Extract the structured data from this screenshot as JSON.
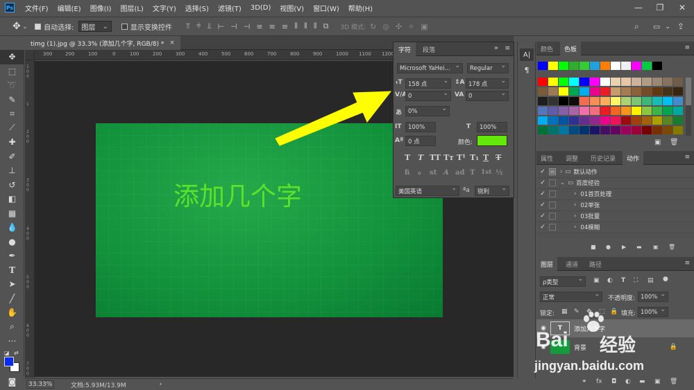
{
  "app": {
    "logo": "Ps"
  },
  "menu": [
    "文件(F)",
    "编辑(E)",
    "图像(I)",
    "图层(L)",
    "文字(Y)",
    "选择(S)",
    "滤镜(T)",
    "3D(D)",
    "视图(V)",
    "窗口(W)",
    "帮助(H)"
  ],
  "window_controls": [
    "—",
    "❐",
    "✕"
  ],
  "options": {
    "auto_select_label": "自动选择:",
    "auto_select_value": "图层",
    "show_transform_label": "显示变换控件",
    "mode_3d_label": "3D 模式:"
  },
  "doc_tab": {
    "title": "timg (1).jpg @ 33.3% (添加几个字, RGB/8) *",
    "close": "×"
  },
  "ruler_h": [
    "300",
    "200",
    "100",
    "0",
    "100",
    "200",
    "300",
    "400",
    "500",
    "600",
    "700",
    "800",
    "900",
    "1000",
    "1100",
    "1200",
    "1300"
  ],
  "ruler_v": [
    "1",
    "0",
    "0",
    "1",
    "2",
    "0",
    "0",
    "3",
    "0",
    "0",
    "4",
    "0",
    "0",
    "5",
    "0",
    "0",
    "6",
    "0",
    "0",
    "7",
    "0",
    "0"
  ],
  "canvas": {
    "text": "添加几个字",
    "text_color": "#5de22a",
    "bg_color": "#139b3c"
  },
  "status": {
    "zoom": "33.33%",
    "doc_size": "文档:5.93M/13.9M",
    "arrow": "›"
  },
  "character_panel": {
    "tabs": [
      "字符",
      "段落"
    ],
    "font_family": "Microsoft YaHei...",
    "font_style": "Regular",
    "font_size": "158 点",
    "leading": "178 点",
    "kerning": "0",
    "tracking": "0",
    "tsume": "0%",
    "v_scale": "100%",
    "h_scale": "100%",
    "baseline": "0 点",
    "color_label": "颜色:",
    "color": "#64e80a",
    "language": "美国英语",
    "aa_label": "ªa",
    "anti_alias": "锐利",
    "style_buttons": [
      "T",
      "T",
      "TT",
      "Tт",
      "T¹",
      "T₁",
      "T",
      "T"
    ],
    "opentype_buttons": [
      "fi",
      "ℴ",
      "st",
      "A",
      "ad",
      "T",
      "1st",
      "½"
    ]
  },
  "mini_strip": {
    "items": [
      "A|",
      "¶"
    ]
  },
  "swatches_panel": {
    "tabs": [
      "颜色",
      "色板"
    ],
    "rows": [
      [
        "#0000ff",
        "#ffff00",
        "#00ff00",
        "#2fae2f",
        "#33cc33",
        "#1fa1e0",
        "#ff8000",
        "#ffffff",
        "#f0f0f0",
        "#ff00ff",
        "#00cc44",
        "#000000"
      ],
      [
        "#ff0000",
        "#ffff00",
        "#00ff00",
        "#00ffff",
        "#0000ff",
        "#ff00ff",
        "#ffffff",
        "#e8d3b0",
        "#e6c6a6",
        "#ccb29a",
        "#b19c86",
        "#9b8874",
        "#85725f",
        "#6f5d4a"
      ],
      [
        "#7a5c3c",
        "#9a7b55",
        "#ffff00",
        "#00a651",
        "#00aeef",
        "#ec008c",
        "#ed1c24",
        "#c69c6d",
        "#a67c52",
        "#8c6239",
        "#754c24",
        "#603913",
        "#463219",
        "#362513"
      ],
      [
        "#1e1e1e",
        "#333333",
        "#000000",
        "#0d0d0d",
        "#f26c4f",
        "#f68e56",
        "#fbaf5d",
        "#fff568",
        "#acd373",
        "#7cc576",
        "#3bb878",
        "#1abbb4",
        "#00bff3",
        "#438ccb"
      ],
      [
        "#5574b9",
        "#605ca8",
        "#855fa8",
        "#a864a8",
        "#f06ea9",
        "#f26d7d",
        "#ed1c24",
        "#f26522",
        "#f7941d",
        "#fff200",
        "#8dc63f",
        "#39b54a",
        "#00a651",
        "#00a99d"
      ],
      [
        "#00aeef",
        "#0072bc",
        "#0054a6",
        "#2e3192",
        "#662d91",
        "#92278f",
        "#ec008c",
        "#ed145b",
        "#9e0b0f",
        "#a0410d",
        "#a3620a",
        "#aba000",
        "#598527",
        "#197b30"
      ],
      [
        "#007236",
        "#00746b",
        "#0076a3",
        "#004a80",
        "#003471",
        "#1b1464",
        "#440e62",
        "#630460",
        "#9e005d",
        "#9e0039",
        "#790000",
        "#7b2e00",
        "#7d4900",
        "#827b00"
      ]
    ]
  },
  "actions_panel": {
    "tabs": [
      "属性",
      "调整",
      "历史记录",
      "动作"
    ],
    "items": [
      {
        "check": "✓",
        "label": "默认动作",
        "kind": "folder",
        "open": false
      },
      {
        "check": "✓",
        "label": "百度经验",
        "kind": "folder",
        "open": true
      },
      {
        "check": "✓",
        "label": "01首页处理",
        "kind": "action"
      },
      {
        "check": "✓",
        "label": "02单张",
        "kind": "action"
      },
      {
        "check": "✓",
        "label": "03批量",
        "kind": "action"
      },
      {
        "check": "✓",
        "label": "04模糊",
        "kind": "action"
      }
    ],
    "footer": [
      "■",
      "●",
      "▶",
      "▬",
      "▣",
      "🗑"
    ]
  },
  "layers_panel": {
    "tabs": [
      "图层",
      "通道",
      "路径"
    ],
    "filter": "ρ类型",
    "blend": "正常",
    "opacity_label": "不透明度:",
    "opacity": "100%",
    "lock_label": "锁定:",
    "fill_label": "填充:",
    "fill": "100%",
    "layers": [
      {
        "name": "添加几个字",
        "kind": "text"
      },
      {
        "name": "背景",
        "kind": "image"
      }
    ],
    "footer": [
      "⚭",
      "fx",
      "◘",
      "◐",
      "▬",
      "▣",
      "🗑"
    ]
  },
  "watermark": {
    "brand": "Bai",
    "brand2": "经验",
    "url": "jingyan.baidu.com"
  },
  "annotation_arrow_color": "#ffff00"
}
